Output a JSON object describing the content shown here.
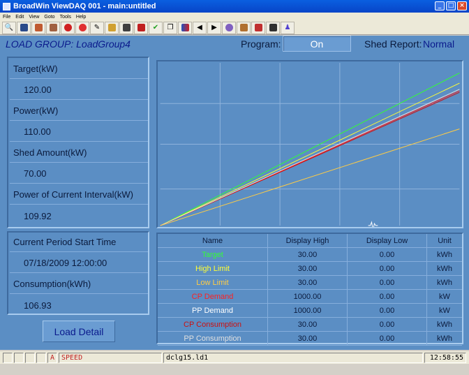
{
  "window": {
    "title": "BroadWin ViewDAQ 001 - main:untitled"
  },
  "menu": [
    "File",
    "Edit",
    "View",
    "Goto",
    "Tools",
    "Help"
  ],
  "toolbar_icons": [
    "search-icon",
    "database-icon",
    "chart-icon",
    "chart2-icon",
    "record-icon",
    "record2-icon",
    "pencil-icon",
    "key-icon",
    "camera-icon",
    "check-box-icon",
    "checkmark-icon",
    "windows-icon",
    "palette-icon",
    "arrow-left-icon",
    "arrow-right-icon",
    "cd-icon",
    "book-icon",
    "eraser-icon",
    "clapper-icon",
    "person-icon"
  ],
  "header": {
    "group_title": "LOAD GROUP: LoadGroup4",
    "program_label": "Program:",
    "program_value": "On",
    "shed_label": "Shed Report:",
    "shed_value": "Normal"
  },
  "left_panel": {
    "target_label": "Target(kW)",
    "target_value": "120.00",
    "power_label": "Power(kW)",
    "power_value": "110.00",
    "shed_amount_label": "Shed Amount(kW)",
    "shed_amount_value": "70.00",
    "power_interval_label": "Power of Current Interval(kW)",
    "power_interval_value": "109.92"
  },
  "period_panel": {
    "start_label": "Current Period Start Time",
    "start_value": "07/18/2009 12:00:00",
    "consumption_label": "Consumption(kWh)",
    "consumption_value": "106.93"
  },
  "load_detail_button": "Load Detail",
  "table": {
    "headers": [
      "Name",
      "Display High",
      "Display Low",
      "Unit"
    ],
    "rows": [
      {
        "name": "Target",
        "high": "30.00",
        "low": "0.00",
        "unit": "kWh",
        "color": "#33ff33"
      },
      {
        "name": "High Limit",
        "high": "30.00",
        "low": "0.00",
        "unit": "kWh",
        "color": "#ffff33"
      },
      {
        "name": "Low Limit",
        "high": "30.00",
        "low": "0.00",
        "unit": "kWh",
        "color": "#ffcc44"
      },
      {
        "name": "CP Demand",
        "high": "1000.00",
        "low": "0.00",
        "unit": "kW",
        "color": "#ff2020"
      },
      {
        "name": "PP Demand",
        "high": "1000.00",
        "low": "0.00",
        "unit": "kW",
        "color": "#ffffff"
      },
      {
        "name": "CP Consumption",
        "high": "30.00",
        "low": "0.00",
        "unit": "kWh",
        "color": "#cc1010"
      },
      {
        "name": "PP Consumption",
        "high": "30.00",
        "low": "0.00",
        "unit": "kWh",
        "color": "#e0e0e0"
      }
    ]
  },
  "chart_data": {
    "type": "line",
    "grid": true,
    "series": [
      {
        "color": "#33ff33",
        "values": [
          0,
          30
        ]
      },
      {
        "color": "#ffff33",
        "values": [
          0,
          28
        ]
      },
      {
        "color": "#ff2020",
        "values": [
          0,
          26.5
        ]
      },
      {
        "color": "#cc1010",
        "values": [
          0,
          26.2
        ]
      },
      {
        "color": "#e0e0e0",
        "values": [
          0,
          26.8
        ]
      },
      {
        "color": "#ffcc44",
        "values": [
          0,
          19
        ]
      }
    ]
  },
  "status": {
    "alarm_marker": "A",
    "speed_label": "SPEED",
    "file": "dclg15.ld1",
    "time": "12:58:55"
  }
}
